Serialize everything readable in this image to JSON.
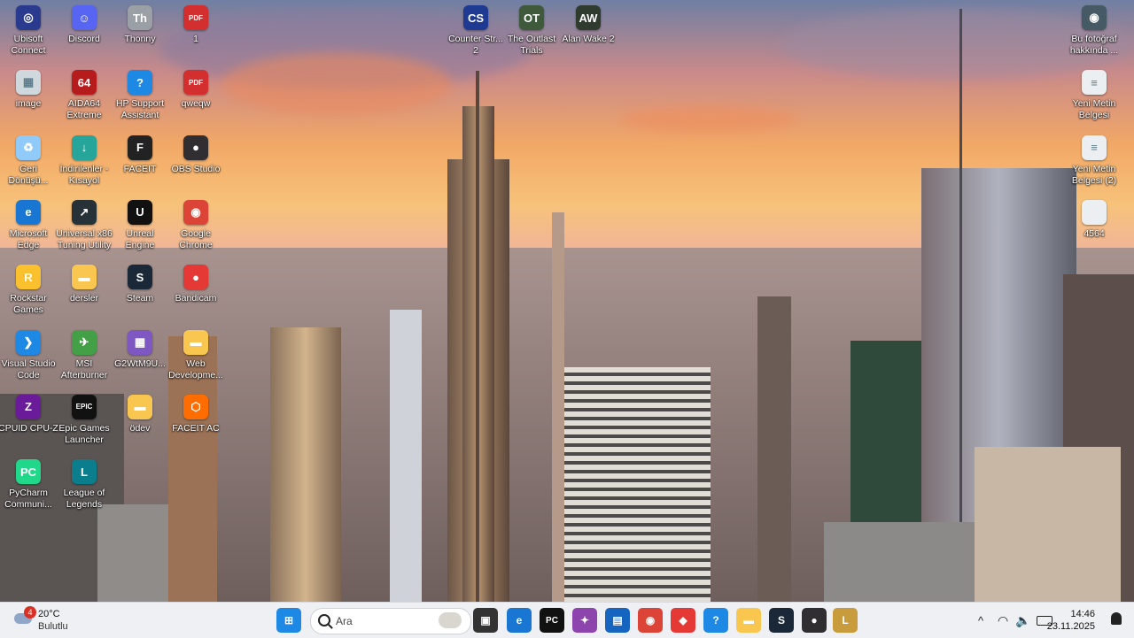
{
  "desktop": {
    "left_icons": [
      {
        "name": "ubisoft-connect",
        "label": "Ubisoft\nConnect",
        "icon": "ubisoft-icon",
        "color": "#2a3b8f",
        "glyph": "◎"
      },
      {
        "name": "discord",
        "label": "Discord",
        "icon": "discord-icon",
        "color": "#5865f2",
        "glyph": "☺"
      },
      {
        "name": "thonny",
        "label": "Thonny",
        "icon": "thonny-icon",
        "color": "#9aa0a6",
        "glyph": "Th"
      },
      {
        "name": "pdf-1",
        "label": "1",
        "icon": "pdf-icon",
        "color": "#d32f2f",
        "glyph": "PDF"
      },
      {
        "name": "image",
        "label": "image",
        "icon": "image-file-icon",
        "color": "#cfd8dc",
        "glyph": "▦"
      },
      {
        "name": "aida64",
        "label": "AIDA64\nExtreme",
        "icon": "aida64-icon",
        "color": "#b71c1c",
        "glyph": "64"
      },
      {
        "name": "hp-support",
        "label": "HP Support\nAssistant",
        "icon": "help-icon",
        "color": "#1e88e5",
        "glyph": "?"
      },
      {
        "name": "qweqw",
        "label": "qweqw",
        "icon": "pdf-icon",
        "color": "#d32f2f",
        "glyph": "PDF"
      },
      {
        "name": "recycle-bin",
        "label": "Geri\nDönüşü...",
        "icon": "recycle-bin-icon",
        "color": "#90caf9",
        "glyph": "♻"
      },
      {
        "name": "downloads",
        "label": "İndirilenler -\nKısayol",
        "icon": "downloads-folder-icon",
        "color": "#26a69a",
        "glyph": "↓"
      },
      {
        "name": "faceit",
        "label": "FACEIT",
        "icon": "faceit-icon",
        "color": "#222222",
        "glyph": "F"
      },
      {
        "name": "obs-studio",
        "label": "OBS Studio",
        "icon": "obs-icon",
        "color": "#302e31",
        "glyph": "●"
      },
      {
        "name": "microsoft-edge",
        "label": "Microsoft\nEdge",
        "icon": "edge-icon",
        "color": "#1976d2",
        "glyph": "e"
      },
      {
        "name": "universal-x86",
        "label": "Universal x86\nTuning Utility",
        "icon": "tuning-utility-icon",
        "color": "#263238",
        "glyph": "↗"
      },
      {
        "name": "unreal-engine",
        "label": "Unreal\nEngine",
        "icon": "unreal-engine-icon",
        "color": "#111111",
        "glyph": "U"
      },
      {
        "name": "google-chrome",
        "label": "Google\nChrome",
        "icon": "chrome-icon",
        "color": "#db4437",
        "glyph": "◉"
      },
      {
        "name": "rockstar-games",
        "label": "Rockstar\nGames",
        "icon": "rockstar-icon",
        "color": "#fbc02d",
        "glyph": "R"
      },
      {
        "name": "dersler",
        "label": "dersler",
        "icon": "folder-icon",
        "color": "#f9c74f",
        "glyph": "▬"
      },
      {
        "name": "steam",
        "label": "Steam",
        "icon": "steam-icon",
        "color": "#1b2838",
        "glyph": "S"
      },
      {
        "name": "bandicam",
        "label": "Bandicam",
        "icon": "bandicam-icon",
        "color": "#e53935",
        "glyph": "●"
      },
      {
        "name": "vscode",
        "label": "Visual Studio\nCode",
        "icon": "vscode-icon",
        "color": "#1e88e5",
        "glyph": "❯"
      },
      {
        "name": "msi-afterburner",
        "label": "MSI\nAfterburner",
        "icon": "afterburner-icon",
        "color": "#43a047",
        "glyph": "✈"
      },
      {
        "name": "g2wtm9u",
        "label": "G2WtM9U...",
        "icon": "image-file-icon",
        "color": "#7e57c2",
        "glyph": "▦"
      },
      {
        "name": "web-development",
        "label": "Web\nDevelopme...",
        "icon": "folder-icon",
        "color": "#f9c74f",
        "glyph": "▬"
      },
      {
        "name": "cpuid-cpu-z",
        "label": "CPUID CPU-Z",
        "icon": "cpu-z-icon",
        "color": "#6a1b9a",
        "glyph": "Z"
      },
      {
        "name": "epic-games",
        "label": "Epic Games\nLauncher",
        "icon": "epic-games-icon",
        "color": "#111111",
        "glyph": "EPIC"
      },
      {
        "name": "odev",
        "label": "ödev",
        "icon": "folder-icon",
        "color": "#f9c74f",
        "glyph": "▬"
      },
      {
        "name": "faceit-ac",
        "label": "FACEIT AC",
        "icon": "faceit-ac-icon",
        "color": "#ff6d00",
        "glyph": "⬡"
      },
      {
        "name": "pycharm",
        "label": "PyCharm\nCommuni...",
        "icon": "pycharm-icon",
        "color": "#21d789",
        "glyph": "PC"
      },
      {
        "name": "league-of-legends",
        "label": "League of\nLegends",
        "icon": "league-icon",
        "color": "#0a7e8c",
        "glyph": "L"
      }
    ],
    "top_icons": [
      {
        "name": "counter-strike-2",
        "label": "Counter Str...\n2",
        "icon": "cs2-icon",
        "color": "#1f3a93",
        "glyph": "CS"
      },
      {
        "name": "the-outlast-trials",
        "label": "The Outlast\nTrials",
        "icon": "outlast-icon",
        "color": "#3e5a3b",
        "glyph": "OT"
      },
      {
        "name": "alan-wake-2",
        "label": "Alan Wake 2",
        "icon": "alan-wake-icon",
        "color": "#2e3b2e",
        "glyph": "AW"
      }
    ],
    "right_icons": [
      {
        "name": "about-photo",
        "label": "Bu fotoğraf\nhakkında ...",
        "icon": "camera-info-icon",
        "color": "#455a64",
        "glyph": "◉"
      },
      {
        "name": "new-text-doc",
        "label": "Yeni Metin\nBelgesi",
        "icon": "text-file-icon",
        "color": "#eceff1",
        "glyph": "≡"
      },
      {
        "name": "new-text-doc-2",
        "label": "Yeni Metin\nBelgesi (2)",
        "icon": "text-file-icon",
        "color": "#eceff1",
        "glyph": "≡"
      },
      {
        "name": "file-4564",
        "label": "4564",
        "icon": "blank-file-icon",
        "color": "#eceff1",
        "glyph": ""
      }
    ]
  },
  "taskbar": {
    "weather": {
      "temp": "20°C",
      "condition": "Bulutlu",
      "badge": "4"
    },
    "search_placeholder": "Ara",
    "apps": [
      {
        "name": "windows-start",
        "icon": "windows-icon",
        "color": "#1e88e5",
        "glyph": "⊞"
      },
      {
        "name": "task-view",
        "icon": "task-view-icon",
        "color": "#333333",
        "glyph": "▣"
      },
      {
        "name": "edge",
        "icon": "edge-icon",
        "color": "#1976d2",
        "glyph": "e"
      },
      {
        "name": "pycharm",
        "icon": "pycharm-icon",
        "color": "#111111",
        "glyph": "PC"
      },
      {
        "name": "copilot",
        "icon": "copilot-icon",
        "color": "#8e44ad",
        "glyph": "✦"
      },
      {
        "name": "store",
        "icon": "store-icon",
        "color": "#1565c0",
        "glyph": "▤"
      },
      {
        "name": "chrome",
        "icon": "chrome-icon",
        "color": "#db4437",
        "glyph": "◉"
      },
      {
        "name": "gem-app",
        "icon": "gem-icon",
        "color": "#e53935",
        "glyph": "◆"
      },
      {
        "name": "hp-support",
        "icon": "help-icon",
        "color": "#1e88e5",
        "glyph": "?"
      },
      {
        "name": "file-explorer",
        "icon": "folder-icon",
        "color": "#f9c74f",
        "glyph": "▬"
      },
      {
        "name": "steam",
        "icon": "steam-icon",
        "color": "#1b2838",
        "glyph": "S"
      },
      {
        "name": "obs",
        "icon": "obs-icon",
        "color": "#302e31",
        "glyph": "●"
      },
      {
        "name": "league",
        "icon": "league-icon",
        "color": "#c89b3c",
        "glyph": "L"
      }
    ],
    "tray": {
      "chevron": "^"
    },
    "clock": {
      "time": "14:46",
      "date": "23.11.2025"
    }
  }
}
